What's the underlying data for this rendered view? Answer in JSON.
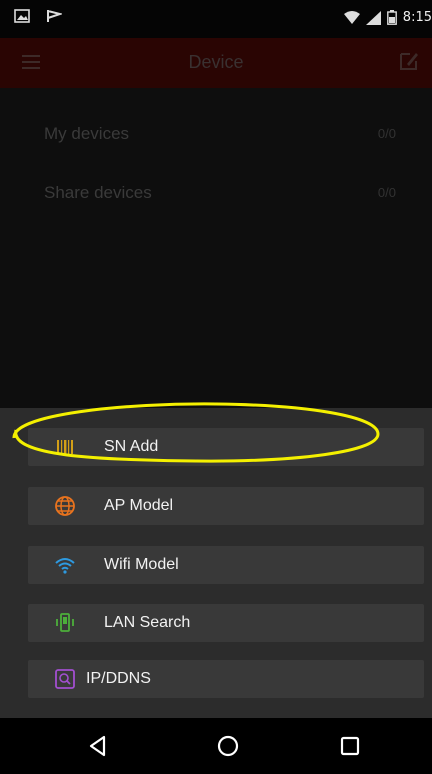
{
  "status_bar": {
    "time": "8:15"
  },
  "app_bar": {
    "title": "Device"
  },
  "devices": [
    {
      "label": "My devices",
      "count": "0/0"
    },
    {
      "label": "Share devices",
      "count": "0/0"
    }
  ],
  "add_menu": {
    "options": [
      {
        "label": "SN Add",
        "icon": "barcode-icon",
        "color": "#d4a017"
      },
      {
        "label": "AP Model",
        "icon": "globe-icon",
        "color": "#e8731e"
      },
      {
        "label": "Wifi Model",
        "icon": "wifi-icon",
        "color": "#2e9ae0"
      },
      {
        "label": "LAN Search",
        "icon": "lan-phone-icon",
        "color": "#4caf3a"
      },
      {
        "label": "IP/DDNS",
        "icon": "ip-ddns-icon",
        "color": "#a24fd0"
      }
    ]
  },
  "annotation": {
    "color": "#f4f000"
  },
  "nav_bar": {
    "buttons": [
      "back-icon",
      "home-icon",
      "recents-icon"
    ]
  }
}
